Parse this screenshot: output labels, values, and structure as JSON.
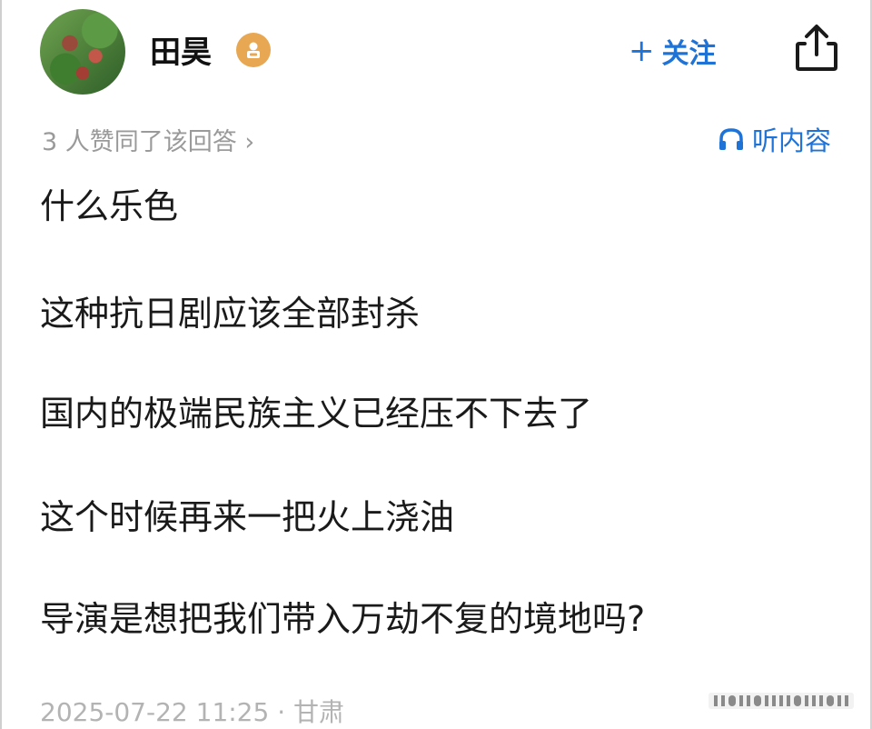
{
  "header": {
    "username": "田昊",
    "follow_label": "关注",
    "follow_plus": "+"
  },
  "meta": {
    "likes_text": "3 人赞同了该回答",
    "likes_chevron": "›",
    "listen_label": "听内容"
  },
  "content": {
    "lines": [
      "什么乐色",
      "这种抗日剧应该全部封杀",
      "国内的极端民族主义已经压不下去了",
      "这个时候再来一把火上浇油",
      "导演是想把我们带入万劫不复的境地吗?"
    ]
  },
  "footer": {
    "timestamp": "2025-07-22 11:25",
    "separator": "·",
    "location": "甘肃"
  },
  "colors": {
    "accent": "#1f73d6",
    "muted": "#9a9a9a",
    "badge": "#e8a752"
  },
  "icons": {
    "share": "share-icon",
    "headphones": "headphones-icon",
    "badge": "user-badge-icon"
  }
}
